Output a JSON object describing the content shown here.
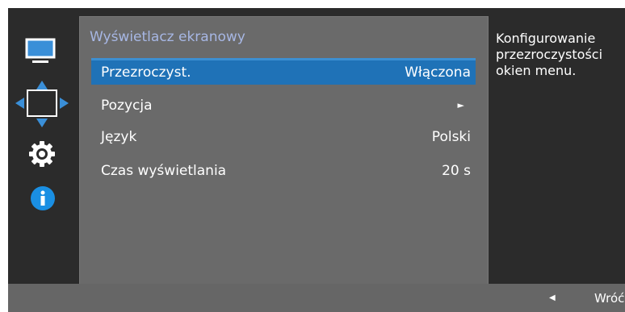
{
  "menu": {
    "title": "Wyświetlacz ekranowy",
    "items": [
      {
        "label": "Przezroczyst.",
        "value": "Włączona"
      },
      {
        "label": "Pozycja",
        "value": ""
      },
      {
        "label": "Język",
        "value": "Polski"
      },
      {
        "label": "Czas wyświetlania",
        "value": "20 s"
      }
    ]
  },
  "description": "Konfigurowanie przezroczystości okien menu.",
  "footer": {
    "return_label": "Wróć",
    "return_icon": "left-triangle-icon"
  },
  "sidebar": {
    "icons": [
      "monitor-icon",
      "move-arrows-icon",
      "gear-icon",
      "info-icon"
    ]
  },
  "colors": {
    "selected_row": "#1f72b7",
    "title_text": "#a7b7e4",
    "info_icon": "#1a8fe3"
  }
}
